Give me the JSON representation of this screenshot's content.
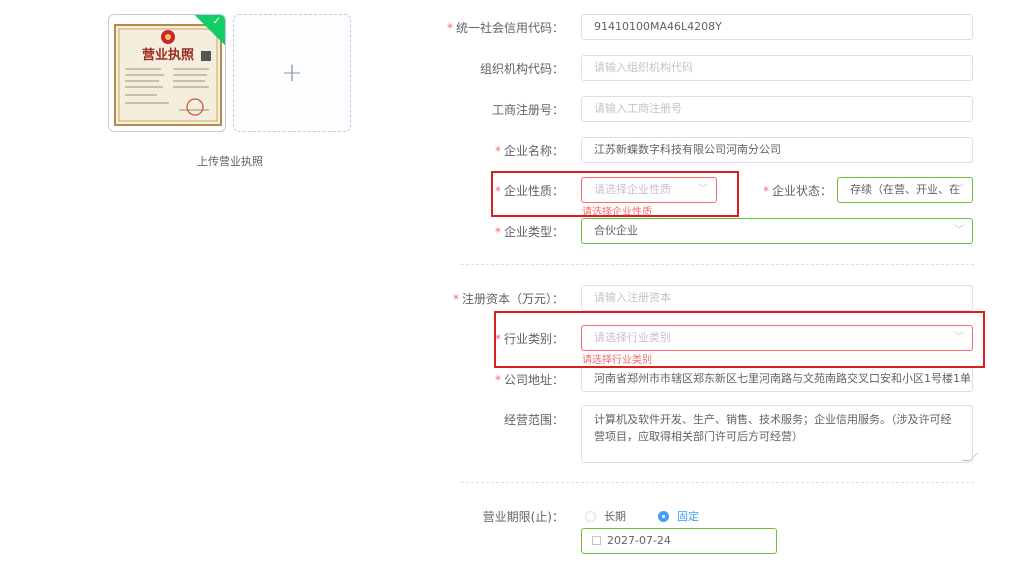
{
  "upload": {
    "caption": "上传营业执照",
    "license_title": "营业执照"
  },
  "form": {
    "credit_code": {
      "label": "统一社会信用代码：",
      "value": "91410100MA46L4208Y",
      "required": true
    },
    "org_code": {
      "label": "组织机构代码：",
      "placeholder": "请输入组织机构代码"
    },
    "reg_no": {
      "label": "工商注册号：",
      "placeholder": "请输入工商注册号"
    },
    "company_name": {
      "label": "企业名称：",
      "value": "江苏新蝶数字科技有限公司河南分公司",
      "required": true
    },
    "company_nature": {
      "label": "企业性质：",
      "placeholder": "请选择企业性质",
      "error": "请选择企业性质",
      "required": true
    },
    "company_status": {
      "label": "企业状态：",
      "value": "存续（在营、开业、在",
      "required": true
    },
    "company_type": {
      "label": "企业类型：",
      "value": "合伙企业",
      "required": true
    },
    "reg_capital": {
      "label": "注册资本（万元）：",
      "placeholder": "请输入注册资本",
      "required": true
    },
    "industry": {
      "label": "行业类别：",
      "placeholder": "请选择行业类别",
      "error": "请选择行业类别",
      "required": true
    },
    "address": {
      "label": "公司地址：",
      "value": "河南省郑州市市辖区郑东新区七里河南路与文苑南路交叉口安和小区1号楼1单",
      "required": true
    },
    "business_scope": {
      "label": "经营范围：",
      "value": "计算机及软件开发、生产、销售、技术服务；企业信用服务。（涉及许可经营项目，应取得相关部门许可后方可经营）"
    },
    "term": {
      "label": "营业期限(止)：",
      "options": [
        "长期",
        "固定"
      ],
      "selected": "固定",
      "date": "2027-07-24"
    }
  },
  "colors": {
    "error": "#f56c6c",
    "success": "#67c23a",
    "primary": "#409eff",
    "highlight": "#d81e1e",
    "upload_badge": "#13ce66"
  }
}
